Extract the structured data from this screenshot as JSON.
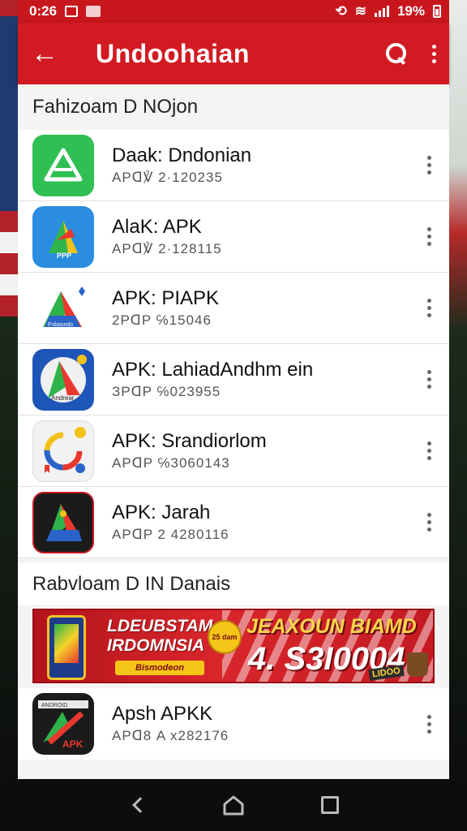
{
  "status_bar": {
    "time": "0:26",
    "battery_text": "19%"
  },
  "app_bar": {
    "title": "Undoohaian"
  },
  "section1": {
    "header": "Fahizoam D NOjon",
    "items": [
      {
        "title": "Daak: Dndonian",
        "subtitle": "APᗡ℣ 2·120235"
      },
      {
        "title": "AlaK: APK",
        "subtitle": "APᗡ℣ 2·128115"
      },
      {
        "title": "APK: PIAPK",
        "subtitle": "2PᗡP ℅15046"
      },
      {
        "title": "APK: LahiadAndhm ein",
        "subtitle": "ЗPᗡP ℅023955"
      },
      {
        "title": "APK: Srandiorlom",
        "subtitle": "APᗡP ℅3060143"
      },
      {
        "title": "APK: Jarah",
        "subtitle": "APᗡP 2 4280116"
      }
    ]
  },
  "section2": {
    "header": "Rabvloam D IN Danais",
    "banner": {
      "line1": "LDEUBSTAM",
      "line2": "IRDOMNSIA",
      "badge": "25 dam",
      "button": "Bismodeon",
      "headline": "JEAXOUN BIAMD",
      "amount": "4. S3I0004",
      "tag": "LIDOO"
    },
    "items": [
      {
        "title": "Apsh APKK",
        "subtitle": "APᗡ8 A x282176"
      }
    ]
  },
  "colors": {
    "primary": "#d21a22",
    "status_bar": "#c7171d"
  }
}
